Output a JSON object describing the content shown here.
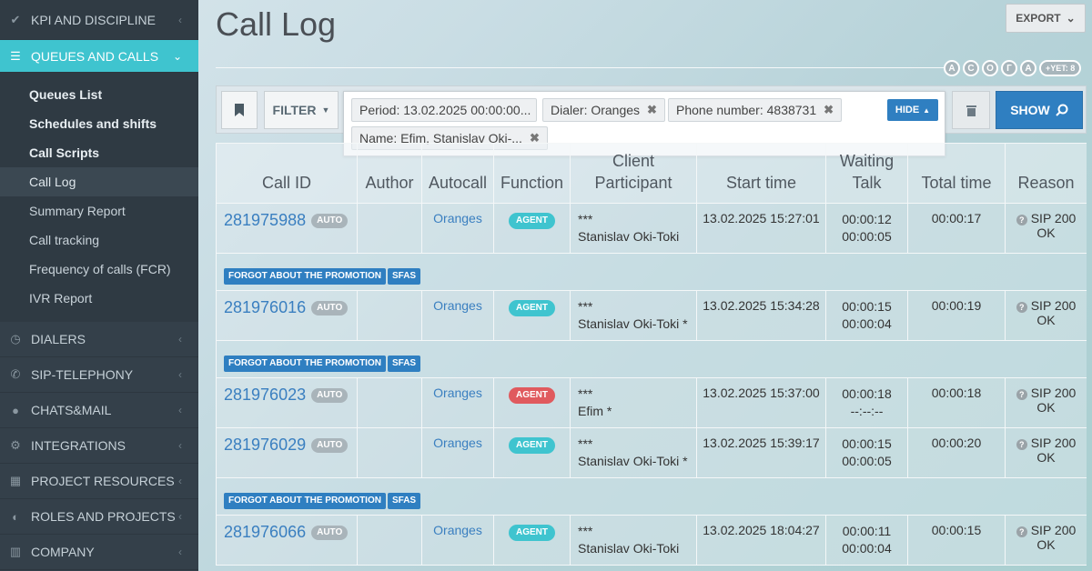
{
  "sidebar": {
    "top": "KPI AND DISCIPLINE",
    "active": "QUEUES AND CALLS",
    "sub": [
      "Queues List",
      "Schedules and shifts",
      "Call Scripts",
      "Call Log",
      "Summary Report",
      "Call tracking",
      "Frequency of calls (FCR)",
      "IVR Report"
    ],
    "sections": [
      "DIALERS",
      "SIP-TELEPHONY",
      "CHATS&MAIL",
      "INTEGRATIONS",
      "PROJECT RESOURCES",
      "ROLES AND PROJECTS",
      "COMPANY"
    ]
  },
  "header": {
    "title": "Call Log",
    "export": "EXPORT"
  },
  "avatars": [
    "A",
    "C",
    "O",
    "Г",
    "A"
  ],
  "avatars_more": "+YET: 8",
  "toolbar": {
    "filter": "FILTER",
    "show": "SHOW",
    "hide": "HIDE"
  },
  "filters": [
    "Period: 13.02.2025 00:00:00...",
    "Dialer: Oranges",
    "Phone number: 4838731",
    "Name: Efim, Stanislav Oki-..."
  ],
  "columns": {
    "call_id": "Call ID",
    "author": "Author",
    "autocall": "Autocall",
    "function": "Function",
    "client": "Client",
    "participant": "Participant",
    "start": "Start time",
    "waiting": "Waiting",
    "talk": "Talk",
    "total": "Total time",
    "reason": "Reason"
  },
  "auto_label": "AUTO",
  "tags": [
    "FORGOT ABOUT THE PROMOTION",
    "SFAS"
  ],
  "rows": [
    {
      "id": "281975988",
      "autocall": "Oranges",
      "function": "AGENT",
      "client": "***",
      "participant": "Stanislav Oki-Toki",
      "start": "13.02.2025 15:27:01",
      "waiting": "00:00:12",
      "talk": "00:00:05",
      "total": "00:00:17",
      "reason": "SIP 200 OK"
    },
    {
      "id": "281976016",
      "autocall": "Oranges",
      "function": "AGENT",
      "client": "***",
      "participant": "Stanislav Oki-Toki *",
      "start": "13.02.2025 15:34:28",
      "waiting": "00:00:15",
      "talk": "00:00:04",
      "total": "00:00:19",
      "reason": "SIP 200 OK"
    },
    {
      "id": "281976023",
      "autocall": "Oranges",
      "function": "AGENT",
      "client": "***",
      "participant": "Efim *",
      "start": "13.02.2025 15:37:00",
      "waiting": "00:00:18",
      "talk": "--:--:--",
      "total": "00:00:18",
      "reason": "SIP 200 OK"
    },
    {
      "id": "281976029",
      "autocall": "Oranges",
      "function": "AGENT",
      "client": "***",
      "participant": "Stanislav Oki-Toki *",
      "start": "13.02.2025 15:39:17",
      "waiting": "00:00:15",
      "talk": "00:00:05",
      "total": "00:00:20",
      "reason": "SIP 200 OK"
    },
    {
      "id": "281976066",
      "autocall": "Oranges",
      "function": "AGENT",
      "client": "***",
      "participant": "Stanislav Oki-Toki",
      "start": "13.02.2025 18:04:27",
      "waiting": "00:00:11",
      "talk": "00:00:04",
      "total": "00:00:15",
      "reason": "SIP 200 OK"
    }
  ]
}
